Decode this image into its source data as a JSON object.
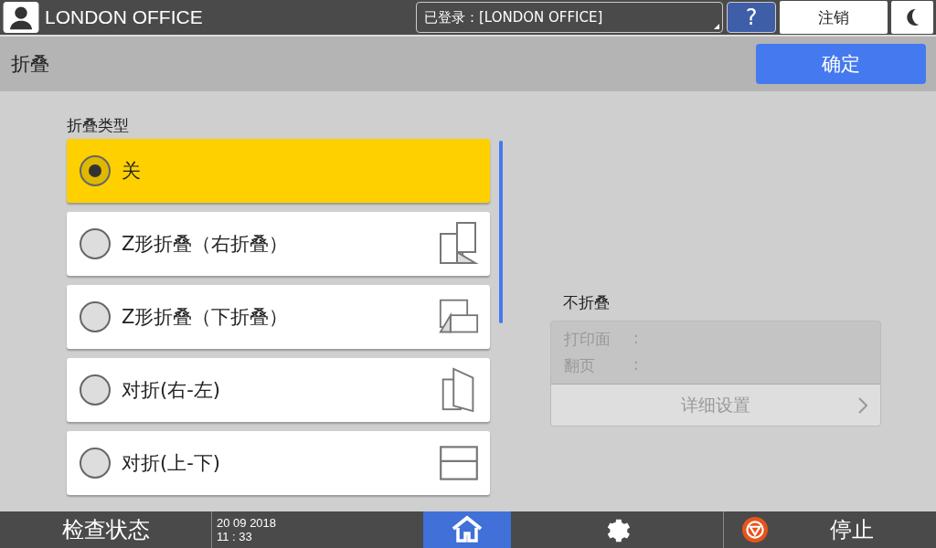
{
  "top_bar": {
    "user": "LONDON OFFICE",
    "login_status": "已登录：[LONDON OFFICE]",
    "help": "?",
    "logout": "注销"
  },
  "header": {
    "title": "折叠",
    "ok": "确定"
  },
  "fold_type": {
    "label": "折叠类型",
    "options": [
      {
        "label": "关",
        "selected": true,
        "kind": "none"
      },
      {
        "label": "Z形折叠（右折叠）",
        "selected": false,
        "kind": "z-right"
      },
      {
        "label": "Z形折叠（下折叠）",
        "selected": false,
        "kind": "z-down"
      },
      {
        "label": "对折(右-左)",
        "selected": false,
        "kind": "half-right"
      },
      {
        "label": "对折(上-下)",
        "selected": false,
        "kind": "half-down"
      }
    ]
  },
  "summary": {
    "title": "不折叠",
    "rows": [
      {
        "label": "打印面",
        "sep": ":"
      },
      {
        "label": "翻页",
        "sep": ":"
      }
    ],
    "details": "详细设置"
  },
  "bottom_bar": {
    "status": "检查状态",
    "date": "20 09 2018",
    "time": "11 : 33",
    "stop": "停止"
  }
}
